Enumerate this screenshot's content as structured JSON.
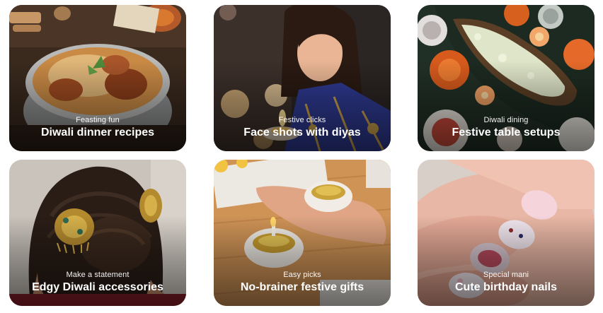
{
  "cards": [
    {
      "subtitle": "Feasting fun",
      "title": "Diwali dinner recipes",
      "image": "biryani-bowl-photo"
    },
    {
      "subtitle": "Festive clicks",
      "title": "Face shots with diyas",
      "image": "woman-with-diya-photo"
    },
    {
      "subtitle": "Diwali dining",
      "title": "Festive table setups",
      "image": "table-setup-photo"
    },
    {
      "subtitle": "Make a statement",
      "title": "Edgy Diwali accessories",
      "image": "hair-accessory-photo"
    },
    {
      "subtitle": "Easy picks",
      "title": "No-brainer festive gifts",
      "image": "marble-diya-gift-photo"
    },
    {
      "subtitle": "Special mani",
      "title": "Cute birthday nails",
      "image": "nail-art-photo"
    }
  ]
}
